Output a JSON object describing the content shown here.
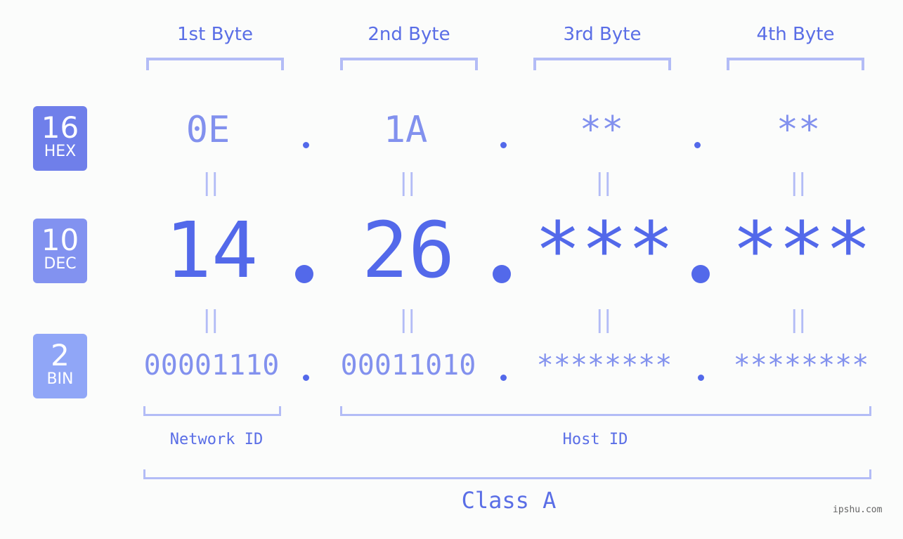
{
  "bytes": [
    {
      "label": "1st Byte",
      "hex": "0E",
      "dec": "14",
      "bin": "00001110"
    },
    {
      "label": "2nd Byte",
      "hex": "1A",
      "dec": "26",
      "bin": "00011010"
    },
    {
      "label": "3rd Byte",
      "hex": "**",
      "dec": "***",
      "bin": "********"
    },
    {
      "label": "4th Byte",
      "hex": "**",
      "dec": "***",
      "bin": "********"
    }
  ],
  "badges": {
    "hex": {
      "num": "16",
      "label": "HEX",
      "color": "#6f7fea"
    },
    "dec": {
      "num": "10",
      "label": "DEC",
      "color": "#8292f0"
    },
    "bin": {
      "num": "2",
      "label": "BIN",
      "color": "#90a6f7"
    }
  },
  "equals_sign": "||",
  "network_id_label": "Network ID",
  "host_id_label": "Host ID",
  "class_label": "Class A",
  "watermark": "ipshu.com"
}
